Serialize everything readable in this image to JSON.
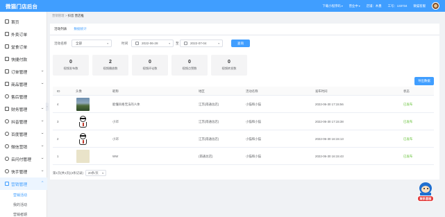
{
  "app": {
    "title": "微猫门店后台"
  },
  "topbar": {
    "download": "下载小程序码",
    "switch": "营业中",
    "store": "店铺：木墨",
    "job_no": "工号：133734",
    "user": "微猫客服"
  },
  "sidebar": {
    "items": [
      {
        "label": "首页",
        "expandable": false
      },
      {
        "label": "外卖订单",
        "expandable": false
      },
      {
        "label": "堂食订单",
        "expandable": false
      },
      {
        "label": "快捷付款",
        "expandable": false
      },
      {
        "label": "订单管理",
        "expandable": true
      },
      {
        "label": "商品管理",
        "expandable": true
      },
      {
        "label": "售后管理",
        "expandable": false
      },
      {
        "label": "财务管理",
        "expandable": true
      },
      {
        "label": "抖音管理",
        "expandable": true
      },
      {
        "label": "百度管理",
        "expandable": true
      },
      {
        "label": "微信营销",
        "expandable": true
      },
      {
        "label": "云闪付管理",
        "expandable": true
      },
      {
        "label": "快手管理",
        "expandable": true
      },
      {
        "label": "营销管理",
        "expandable": true,
        "active": true
      }
    ],
    "subitems": [
      {
        "label": "营销活动",
        "active": true
      },
      {
        "label": "我的活动"
      },
      {
        "label": "营销者期"
      }
    ]
  },
  "breadcrumb": {
    "parent": "营销管理",
    "separator": ">",
    "current": "抖音 营店推"
  },
  "tabs": [
    {
      "label": "活动列表",
      "active": false
    },
    {
      "label": "数据统计",
      "active": true
    }
  ],
  "filters": {
    "activity_label": "活动名称",
    "activity_value": "全部",
    "time_label": "时间",
    "start_date": "2022-06-28",
    "to_label": "至",
    "end_date": "2022-07-04",
    "query_button": "查询"
  },
  "stats": [
    {
      "value": "0",
      "label": "视频发布数"
    },
    {
      "value": "2",
      "label": "视频播放数"
    },
    {
      "value": "0",
      "label": "视频评论数"
    },
    {
      "value": "0",
      "label": "视频点赞数"
    },
    {
      "value": "0",
      "label": "视频转发数"
    }
  ],
  "export_button": "导出数据",
  "table": {
    "headers": [
      "ID",
      "头像",
      "昵称",
      "地区",
      "活动名称",
      "发布时间",
      "状态"
    ],
    "rows": [
      {
        "id": "4",
        "avatar": "landscape",
        "nickname": "能懂风格无法的人体",
        "region": "江苏(南通总店)",
        "activity": "小猫和小猫",
        "time": "2022-06-30 17:15:56",
        "status": "已发布"
      },
      {
        "id": "3",
        "avatar": "sketch",
        "nickname": "小邓",
        "region": "江苏(南通总店)",
        "activity": "小猫和小猫",
        "time": "2022-06-30 17:15:38",
        "status": "已发布"
      },
      {
        "id": "2",
        "avatar": "sketch",
        "nickname": "小邓",
        "region": "江苏(南通总店)",
        "activity": "小猫和小猫",
        "time": "2022-06-30 16:15:13",
        "status": "已发布"
      },
      {
        "id": "1",
        "avatar": "beige",
        "nickname": "WW",
        "region": "(南通总店)",
        "activity": "小猫和小猫",
        "time": "2022-06-30 16:15:43",
        "status": "已发布"
      }
    ]
  },
  "pagination": {
    "summary": "第1页(共1页)(4条记录)",
    "page_size": "20条/页"
  },
  "mascot": {
    "label": "联系客服"
  }
}
